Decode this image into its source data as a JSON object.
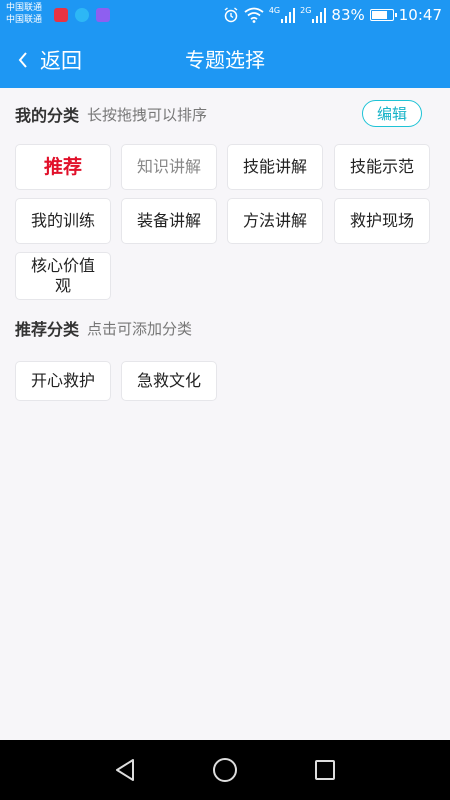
{
  "status_bar": {
    "carrier_1": "中国联通",
    "carrier_2": "中国联通",
    "net_1": "4G",
    "net_2": "2G",
    "battery": "83%",
    "battery_level": 0.83,
    "time": "10:47",
    "app_icon_colors": [
      "#e83344",
      "#2db7f5",
      "#8e5ff0"
    ]
  },
  "header": {
    "back_label": "返回",
    "title": "专题选择",
    "back_icon": "chevron-left-icon"
  },
  "my_categories": {
    "title": "我的分类",
    "hint": "长按拖拽可以排序",
    "edit_label": "编辑",
    "tags": [
      "推荐",
      "知识讲解",
      "技能讲解",
      "技能示范",
      "我的训练",
      "装备讲解",
      "方法讲解",
      "救护现场",
      "核心价值观"
    ]
  },
  "recommended_categories": {
    "title": "推荐分类",
    "hint": "点击可添加分类",
    "tags": [
      "开心救护",
      "急救文化"
    ]
  },
  "system_nav": {
    "back_icon": "triangle-back-icon",
    "home_icon": "circle-home-icon",
    "recent_icon": "square-recent-icon"
  },
  "colors": {
    "primary": "#1e97f3",
    "active_tag": "#e1102a",
    "edit_accent": "#17b3c8"
  }
}
